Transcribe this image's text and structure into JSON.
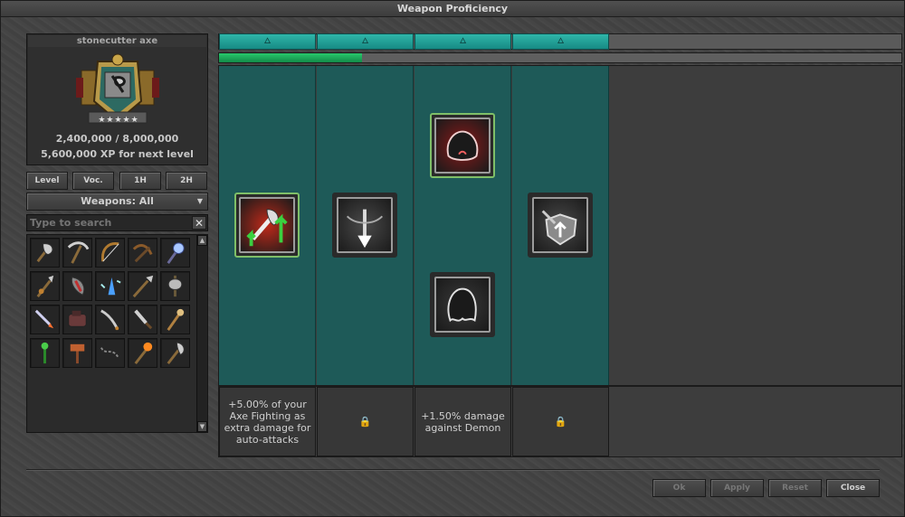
{
  "window": {
    "title": "Weapon Proficiency"
  },
  "weapon": {
    "name": "stonecutter axe",
    "xp_progress": "2,400,000 / 8,000,000",
    "xp_next": "5,600,000 XP for next level",
    "stars": 5
  },
  "filters": {
    "level": "Level",
    "voc": "Voc.",
    "one_hand": "1H",
    "two_hand": "2H"
  },
  "category_select": {
    "value": "Weapons: All"
  },
  "search": {
    "placeholder": "Type to search",
    "clear_icon": "close-icon"
  },
  "weapon_grid": [
    "axe",
    "pickaxe",
    "bow",
    "crossbow",
    "ice-rod",
    "halberd-spear",
    "wand-red",
    "crystal-wand",
    "spear",
    "battle-axe",
    "sword-fire",
    "gauntlet",
    "saber",
    "dagger",
    "rod",
    "green-rod",
    "hammer",
    "chain-whip",
    "fire-staff",
    "double-axe"
  ],
  "tracker": {
    "progress_fraction": 0.21,
    "column_icons": [
      "flame-icon",
      "flame-icon",
      "flame-icon",
      "flame-icon"
    ]
  },
  "perk_columns": [
    {
      "perks": [
        "axe-fighting-boost-icon"
      ],
      "description": "+5.00% of your Axe Fighting as extra damage for auto-attacks",
      "locked": false
    },
    {
      "perks": [
        "piercing-strike-icon"
      ],
      "description": "",
      "locked": true
    },
    {
      "perks": [
        "demon-bane-icon",
        "ghost-icon"
      ],
      "description": "+1.50% damage against Demon",
      "locked": false
    },
    {
      "perks": [
        "shield-axe-icon"
      ],
      "description": "",
      "locked": true
    }
  ],
  "buttons": {
    "ok": "Ok",
    "apply": "Apply",
    "reset": "Reset",
    "close": "Close"
  },
  "colors": {
    "accent": "#1e5a58",
    "progress": "#1fa85a",
    "selected_border": "#7fbf68"
  }
}
